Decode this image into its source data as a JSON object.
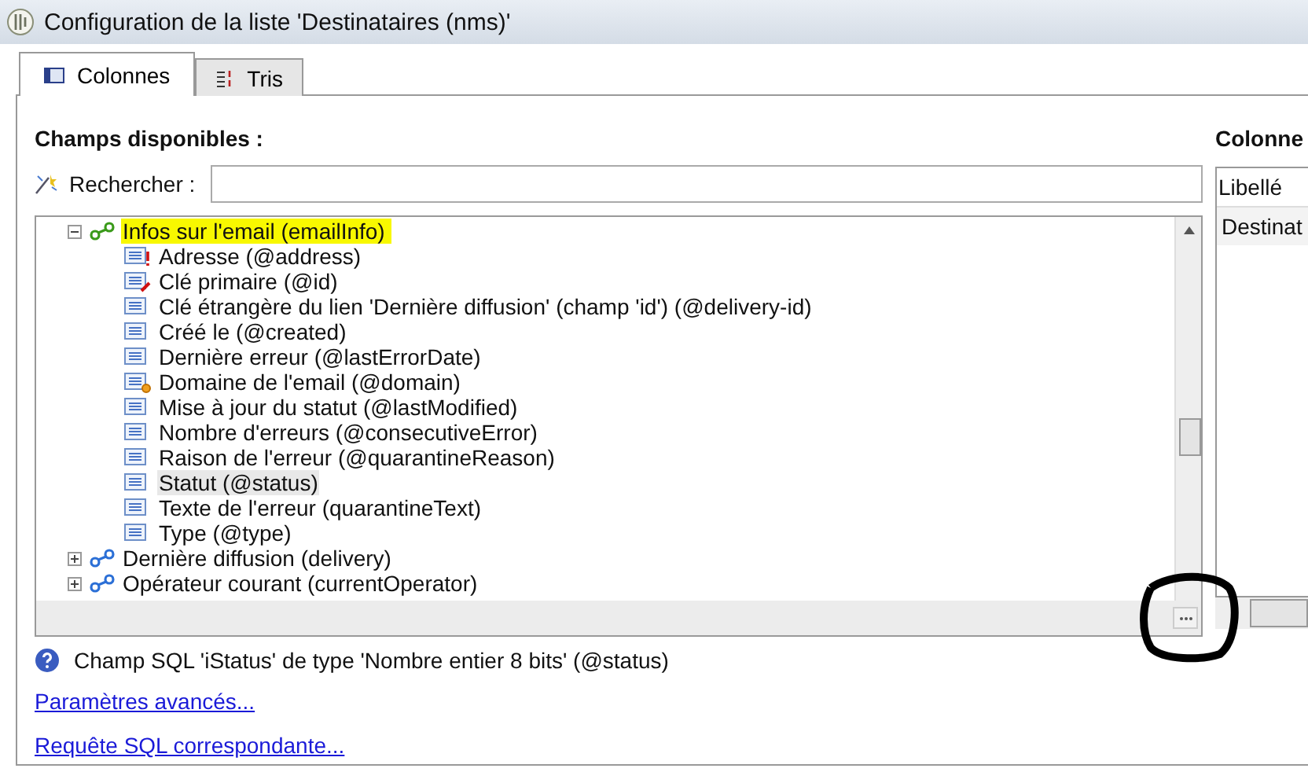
{
  "window": {
    "title": "Configuration de la liste 'Destinataires (nms)'"
  },
  "tabs": [
    {
      "label": "Colonnes",
      "kind": "columns",
      "selected": true
    },
    {
      "label": "Tris",
      "kind": "sort",
      "selected": false
    }
  ],
  "available_fields": {
    "heading": "Champs disponibles :",
    "search": {
      "label": "Rechercher :"
    },
    "tree": [
      {
        "label": "Infos sur l'email (emailInfo)",
        "kind": "link",
        "expanded": true,
        "highlighted": true,
        "selected": false,
        "children": [
          {
            "label": "Adresse (@address)",
            "kind": "mandatory",
            "selected": false
          },
          {
            "label": "Clé primaire (@id)",
            "kind": "key",
            "selected": false
          },
          {
            "label": "Clé étrangère du lien 'Dernière diffusion' (champ 'id') (@delivery-id)",
            "kind": "field",
            "selected": false
          },
          {
            "label": "Créé le (@created)",
            "kind": "field",
            "selected": false
          },
          {
            "label": "Dernière erreur (@lastErrorDate)",
            "kind": "field",
            "selected": false
          },
          {
            "label": "Domaine de l'email (@domain)",
            "kind": "computed",
            "selected": false
          },
          {
            "label": "Mise à jour du statut (@lastModified)",
            "kind": "field",
            "selected": false
          },
          {
            "label": "Nombre d'erreurs (@consecutiveError)",
            "kind": "field",
            "selected": false
          },
          {
            "label": "Raison de l'erreur (@quarantineReason)",
            "kind": "field",
            "selected": false
          },
          {
            "label": "Statut (@status)",
            "kind": "field",
            "selected": true
          },
          {
            "label": "Texte de l'erreur (quarantineText)",
            "kind": "field",
            "selected": false
          },
          {
            "label": "Type (@type)",
            "kind": "field",
            "selected": false
          }
        ]
      },
      {
        "label": "Dernière diffusion (delivery)",
        "kind": "link",
        "expanded": false,
        "highlighted": false,
        "selected": false
      },
      {
        "label": "Opérateur courant (currentOperator)",
        "kind": "link",
        "expanded": false,
        "highlighted": false,
        "selected": false
      }
    ]
  },
  "columns_panel": {
    "heading": "Colonne",
    "table": {
      "columns": [
        "Libellé"
      ],
      "rows": [
        [
          "Destinat"
        ]
      ]
    }
  },
  "info": {
    "text": "Champ SQL 'iStatus' de type 'Nombre entier 8 bits' (@status)"
  },
  "links": [
    "Paramètres avancés...",
    "Requête SQL correspondante..."
  ]
}
